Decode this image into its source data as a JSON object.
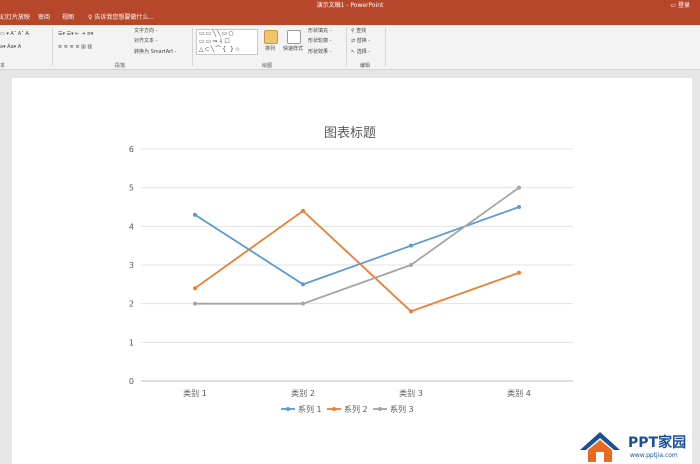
{
  "window": {
    "title": "演示文稿1 - PowerPoint",
    "controls": "▭   登录"
  },
  "tabs": [
    {
      "label": "幻灯片放映"
    },
    {
      "label": "审阅"
    },
    {
      "label": "视图"
    }
  ],
  "search": {
    "label": "告诉我您想要做什么..."
  },
  "ribbon": {
    "paragraph": {
      "label": "段落",
      "text_direction": "文字方向 -",
      "align_text": "对齐文本 -",
      "to_smartart": "转换为 SmartArt -"
    },
    "drawing": {
      "label": "绘图",
      "arrange": "排列",
      "quick_styles": "快速样式",
      "shape_fill": "形状填充 -",
      "shape_outline": "形状轮廓 -",
      "shape_effects": "形状效果 -",
      "shape_glyphs": "▭▭╲╲▭○\n▭▭⇒⇩☐\n△⊂╲⌒{ }☆"
    },
    "editing": {
      "label": "编辑",
      "find": "查找",
      "replace": "替换 -",
      "select": "选择 -"
    },
    "font_label": "本"
  },
  "chart_data": {
    "type": "line",
    "title": "图表标题",
    "categories": [
      "类别 1",
      "类别 2",
      "类别 3",
      "类别 4"
    ],
    "ylim": [
      0,
      6
    ],
    "yticks": [
      "0",
      "1",
      "2",
      "3",
      "4",
      "5",
      "6"
    ],
    "grid": true,
    "legend": "bottom",
    "series": [
      {
        "name": "系列 1",
        "values": [
          4.3,
          2.5,
          3.5,
          4.5
        ],
        "color": "#5b9bd5"
      },
      {
        "name": "系列 2",
        "values": [
          2.4,
          4.4,
          1.8,
          2.8
        ],
        "color": "#ed7d31"
      },
      {
        "name": "系列 3",
        "values": [
          2,
          2,
          3,
          5
        ],
        "color": "#a5a5a5"
      }
    ]
  },
  "watermark": {
    "brand": "PPT家园",
    "url": "www.pptjia.com"
  }
}
